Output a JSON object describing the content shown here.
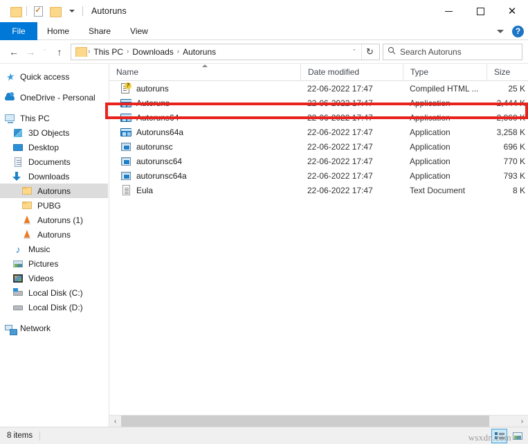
{
  "window": {
    "title": "Autoruns",
    "quick_access": [
      {
        "name": "folder-icon",
        "label": ""
      },
      {
        "name": "properties-icon",
        "label": ""
      },
      {
        "name": "new-folder-icon",
        "label": ""
      },
      {
        "name": "customize-qat-icon",
        "label": ""
      }
    ],
    "controls": {
      "minimize": "–",
      "maximize": "□",
      "close": "✕"
    }
  },
  "ribbon": {
    "tabs": [
      {
        "label": "File",
        "active": true
      },
      {
        "label": "Home",
        "active": false
      },
      {
        "label": "Share",
        "active": false
      },
      {
        "label": "View",
        "active": false
      }
    ],
    "expand_label": "",
    "help_label": "?"
  },
  "address": {
    "back_glyph": "←",
    "forward_glyph": "→",
    "recent_glyph": "ˇ",
    "up_glyph": "↑",
    "crumbs": [
      "This PC",
      "Downloads",
      "Autoruns"
    ],
    "separator": "›",
    "dropdown_glyph": "ˇ",
    "refresh_glyph": "↻"
  },
  "search": {
    "icon": "search-icon",
    "placeholder": "Search Autoruns",
    "value": ""
  },
  "sidebar": {
    "items": [
      {
        "label": "Quick access",
        "icon": "star-icon",
        "indent": 0,
        "selected": false
      },
      {
        "label": "OneDrive - Personal",
        "icon": "cloud-icon",
        "indent": 0,
        "selected": false
      },
      {
        "label": "This PC",
        "icon": "computer-icon",
        "indent": 0,
        "selected": false
      },
      {
        "label": "3D Objects",
        "icon": "cube-icon",
        "indent": 1,
        "selected": false
      },
      {
        "label": "Desktop",
        "icon": "desktop-icon",
        "indent": 1,
        "selected": false
      },
      {
        "label": "Documents",
        "icon": "documents-icon",
        "indent": 1,
        "selected": false
      },
      {
        "label": "Downloads",
        "icon": "download-icon",
        "indent": 1,
        "selected": false
      },
      {
        "label": "Autoruns",
        "icon": "folder-icon",
        "indent": 2,
        "selected": true
      },
      {
        "label": "PUBG",
        "icon": "folder-icon",
        "indent": 2,
        "selected": false
      },
      {
        "label": "Autoruns (1)",
        "icon": "vlc-icon",
        "indent": 2,
        "selected": false
      },
      {
        "label": "Autoruns",
        "icon": "vlc-icon",
        "indent": 2,
        "selected": false
      },
      {
        "label": "Music",
        "icon": "music-icon",
        "indent": 1,
        "selected": false
      },
      {
        "label": "Pictures",
        "icon": "pictures-icon",
        "indent": 1,
        "selected": false
      },
      {
        "label": "Videos",
        "icon": "videos-icon",
        "indent": 1,
        "selected": false
      },
      {
        "label": "Local Disk (C:)",
        "icon": "system-drive-icon",
        "indent": 1,
        "selected": false
      },
      {
        "label": "Local Disk (D:)",
        "icon": "drive-icon",
        "indent": 1,
        "selected": false
      },
      {
        "label": "Network",
        "icon": "network-icon",
        "indent": 0,
        "selected": false
      }
    ]
  },
  "filelist": {
    "columns": [
      {
        "label": "Name",
        "sorted": true
      },
      {
        "label": "Date modified",
        "sorted": false
      },
      {
        "label": "Type",
        "sorted": false
      },
      {
        "label": "Size",
        "sorted": false
      }
    ],
    "rows": [
      {
        "name": "autoruns",
        "date": "22-06-2022 17:47",
        "type": "Compiled HTML ...",
        "size": "25 K",
        "icon": "chm-file-icon",
        "highlighted": false
      },
      {
        "name": "Autoruns",
        "date": "22-06-2022 17:47",
        "type": "Application",
        "size": "2,444 K",
        "icon": "application-icon",
        "highlighted": true
      },
      {
        "name": "Autoruns64",
        "date": "22-06-2022 17:47",
        "type": "Application",
        "size": "2,860 K",
        "icon": "application-icon",
        "highlighted": false
      },
      {
        "name": "Autoruns64a",
        "date": "22-06-2022 17:47",
        "type": "Application",
        "size": "3,258 K",
        "icon": "application-icon",
        "highlighted": false
      },
      {
        "name": "autorunsc",
        "date": "22-06-2022 17:47",
        "type": "Application",
        "size": "696 K",
        "icon": "console-app-icon",
        "highlighted": false
      },
      {
        "name": "autorunsc64",
        "date": "22-06-2022 17:47",
        "type": "Application",
        "size": "770 K",
        "icon": "console-app-icon",
        "highlighted": false
      },
      {
        "name": "autorunsc64a",
        "date": "22-06-2022 17:47",
        "type": "Application",
        "size": "793 K",
        "icon": "console-app-icon",
        "highlighted": false
      },
      {
        "name": "Eula",
        "date": "22-06-2022 17:47",
        "type": "Text Document",
        "size": "8 K",
        "icon": "text-document-icon",
        "highlighted": false
      }
    ]
  },
  "scrollbar": {
    "left_glyph": "‹",
    "right_glyph": "›"
  },
  "status": {
    "item_count": "8 items",
    "view_details_label": "",
    "view_large_icons_label": ""
  },
  "annotation": {
    "color": "#e8221c",
    "target_row": "Autoruns"
  },
  "watermark": {
    "text": "wsxdn.com"
  }
}
